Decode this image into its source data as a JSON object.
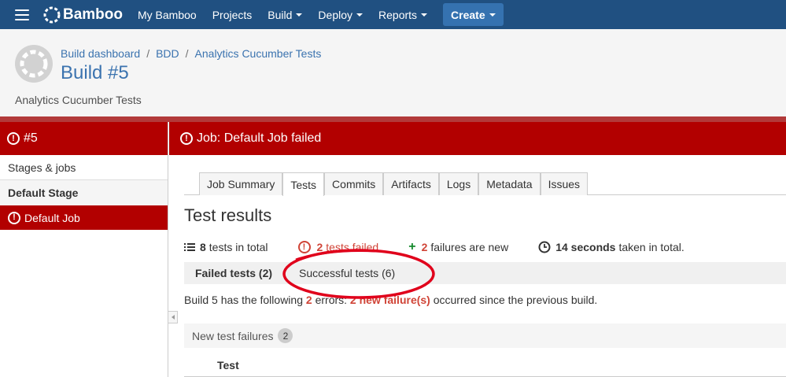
{
  "topnav": {
    "brand": "Bamboo",
    "items": [
      {
        "label": "My Bamboo",
        "dropdown": false
      },
      {
        "label": "Projects",
        "dropdown": false
      },
      {
        "label": "Build",
        "dropdown": true
      },
      {
        "label": "Deploy",
        "dropdown": true
      },
      {
        "label": "Reports",
        "dropdown": true
      }
    ],
    "create_label": "Create",
    "bg_color": "#205081"
  },
  "header": {
    "breadcrumb": [
      "Build dashboard",
      "BDD",
      "Analytics Cucumber Tests"
    ],
    "title": "Build #5",
    "subtitle": "Analytics Cucumber Tests"
  },
  "sidebar": {
    "build_label": "#5",
    "stages_jobs": "Stages & jobs",
    "stage": "Default Stage",
    "job": "Default Job"
  },
  "main": {
    "job_status": "Job: Default Job failed",
    "tabs": [
      {
        "label": "Job Summary",
        "active": false
      },
      {
        "label": "Tests",
        "active": true
      },
      {
        "label": "Commits",
        "active": false
      },
      {
        "label": "Artifacts",
        "active": false
      },
      {
        "label": "Logs",
        "active": false
      },
      {
        "label": "Metadata",
        "active": false
      },
      {
        "label": "Issues",
        "active": false
      }
    ],
    "test_results_title": "Test results",
    "stats": {
      "total_count": "8",
      "total_text": "tests in total",
      "failed_count": "2",
      "failed_text": "tests failed",
      "new_count": "2",
      "new_text": "failures are new",
      "duration": "14 seconds",
      "duration_text": "taken in total."
    },
    "subtabs": {
      "failed": "Failed tests (2)",
      "successful": "Successful tests (6)"
    },
    "errors_line": {
      "prefix": "Build 5 has the following",
      "errors_count": "2",
      "errors_word": "errors:",
      "new_failures": "2 new failure(s)",
      "suffix": "occurred since the previous build."
    },
    "new_failures_header": "New test failures",
    "new_failures_count": "2",
    "column_test": "Test"
  },
  "colors": {
    "failure_red": "#b20000",
    "link_blue": "#3b73af",
    "annotation_red": "#e0001b"
  }
}
